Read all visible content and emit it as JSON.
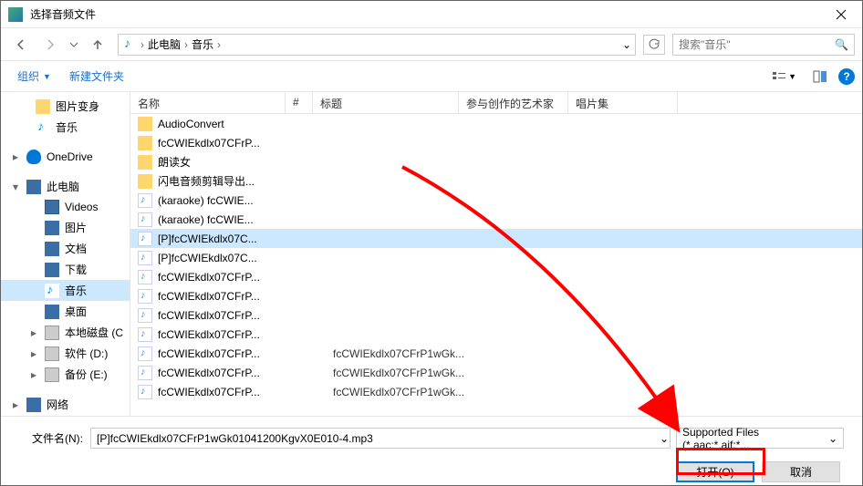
{
  "title": "选择音频文件",
  "breadcrumb": {
    "root": "此电脑",
    "folder": "音乐"
  },
  "search": {
    "placeholder": "搜索\"音乐\""
  },
  "toolbar": {
    "organize": "组织",
    "new_folder": "新建文件夹"
  },
  "tree": {
    "items": [
      {
        "label": "图片变身",
        "icon": "folder",
        "lvl": 2
      },
      {
        "label": "音乐",
        "icon": "music",
        "lvl": 2
      },
      {
        "label": "OneDrive",
        "icon": "cloud",
        "lvl": 1,
        "tri": "▸"
      },
      {
        "label": "此电脑",
        "icon": "pc",
        "lvl": 1,
        "tri": "▾"
      },
      {
        "label": "Videos",
        "icon": "vid",
        "lvl": 2
      },
      {
        "label": "图片",
        "icon": "pic",
        "lvl": 2
      },
      {
        "label": "文档",
        "icon": "doc",
        "lvl": 2
      },
      {
        "label": "下载",
        "icon": "dl",
        "lvl": 2
      },
      {
        "label": "音乐",
        "icon": "music",
        "lvl": 2,
        "sel": true
      },
      {
        "label": "桌面",
        "icon": "desk",
        "lvl": 2
      },
      {
        "label": "本地磁盘 (C",
        "icon": "disk",
        "lvl": 2,
        "tri": "▸"
      },
      {
        "label": "软件 (D:)",
        "icon": "disk",
        "lvl": 2,
        "tri": "▸"
      },
      {
        "label": "备份 (E:)",
        "icon": "disk",
        "lvl": 2,
        "tri": "▸"
      },
      {
        "label": "网络",
        "icon": "net",
        "lvl": 1,
        "tri": "▸"
      }
    ]
  },
  "columns": {
    "name": "名称",
    "index": "#",
    "title": "标题",
    "artist": "参与创作的艺术家",
    "album": "唱片集"
  },
  "files": [
    {
      "name": "AudioConvert",
      "icon": "folder"
    },
    {
      "name": "fcCWIEkdlx07CFrP...",
      "icon": "folder"
    },
    {
      "name": "朗读女",
      "icon": "folder"
    },
    {
      "name": "闪电音频剪辑导出...",
      "icon": "folder"
    },
    {
      "name": "(karaoke) fcCWIE...",
      "icon": "audio"
    },
    {
      "name": "(karaoke) fcCWIE...",
      "icon": "audio"
    },
    {
      "name": "[P]fcCWIEkdlx07C...",
      "icon": "audio",
      "sel": true
    },
    {
      "name": "[P]fcCWIEkdlx07C...",
      "icon": "audio"
    },
    {
      "name": "fcCWIEkdlx07CFrP...",
      "icon": "audio"
    },
    {
      "name": "fcCWIEkdlx07CFrP...",
      "icon": "audio"
    },
    {
      "name": "fcCWIEkdlx07CFrP...",
      "icon": "audio"
    },
    {
      "name": "fcCWIEkdlx07CFrP...",
      "icon": "audio"
    },
    {
      "name": "fcCWIEkdlx07CFrP...",
      "icon": "audio",
      "title": "fcCWIEkdlx07CFrP1wGk..."
    },
    {
      "name": "fcCWIEkdlx07CFrP...",
      "icon": "audio",
      "title": "fcCWIEkdlx07CFrP1wGk..."
    },
    {
      "name": "fcCWIEkdlx07CFrP...",
      "icon": "audio",
      "title": "fcCWIEkdlx07CFrP1wGk..."
    }
  ],
  "footer": {
    "filename_label": "文件名(N):",
    "filename_value": "[P]fcCWIEkdlx07CFrP1wGk01041200KgvX0E010-4.mp3",
    "filter": "Supported Files (*.aac;*.aif;*...",
    "open": "打开(O)",
    "cancel": "取消"
  }
}
